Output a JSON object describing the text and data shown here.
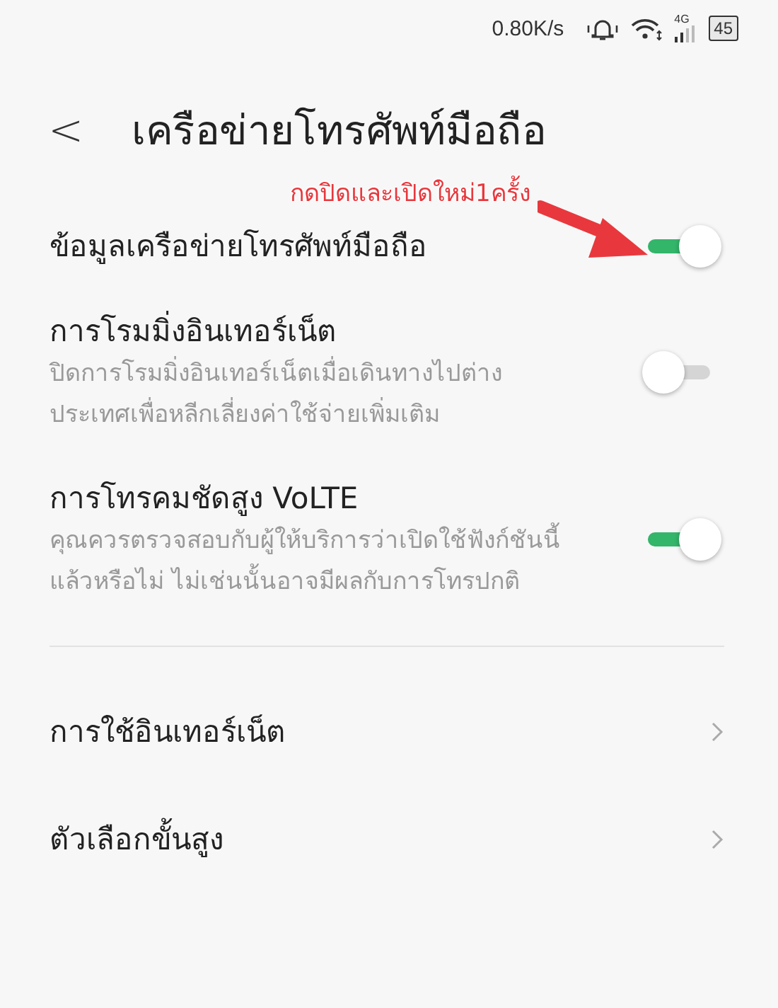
{
  "status_bar": {
    "speed": "0.80K/s",
    "network": "4G",
    "battery": "45"
  },
  "header": {
    "back": "<",
    "title": "เครือข่ายโทรศัพท์มือถือ"
  },
  "annotation": {
    "text": "กดปิดและเปิดใหม่1ครั้ง"
  },
  "settings": [
    {
      "kind": "toggle",
      "title": "ข้อมูลเครือข่ายโทรศัพท์มือถือ",
      "on": true
    },
    {
      "kind": "toggle",
      "title": "การโรมมิ่งอินเทอร์เน็ต",
      "subtitle": "ปิดการโรมมิ่งอินเทอร์เน็ตเมื่อเดินทางไปต่างประเทศเพื่อหลีกเลี่ยงค่าใช้จ่ายเพิ่มเติม",
      "on": false
    },
    {
      "kind": "toggle",
      "title": "การโทรคมชัดสูง VoLTE",
      "subtitle": "คุณควรตรวจสอบกับผู้ให้บริการว่าเปิดใช้ฟังก์ชันนี้แล้วหรือไม่ ไม่เช่นนั้นอาจมีผลกับการโทรปกติ",
      "on": true
    },
    {
      "kind": "link",
      "title": "การใช้อินเทอร์เน็ต"
    },
    {
      "kind": "link",
      "title": "ตัวเลือกขั้นสูง"
    }
  ]
}
